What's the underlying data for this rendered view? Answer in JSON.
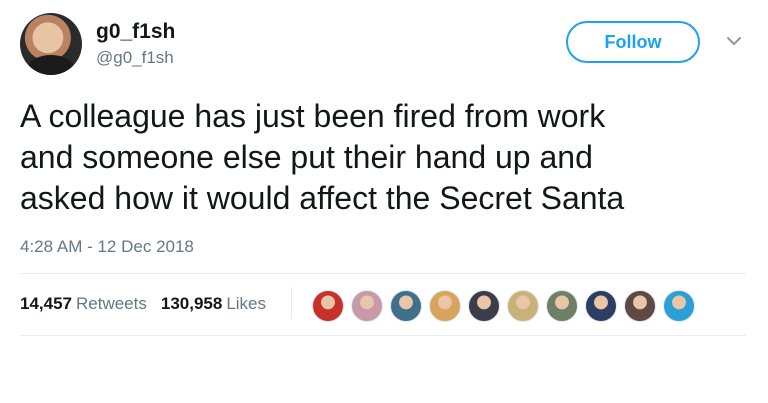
{
  "user": {
    "name": "g0_f1sh",
    "handle": "@g0_f1sh",
    "follow_label": "Follow"
  },
  "tweet": {
    "text_lines": [
      "A colleague has just been fired from work",
      "and someone else put their hand up and",
      "asked how it would affect the Secret Santa"
    ],
    "timestamp": "4:28 AM - 12 Dec 2018"
  },
  "stats": {
    "retweets_count": "14,457",
    "retweets_label": "Retweets",
    "likes_count": "130,958",
    "likes_label": "Likes"
  },
  "likers": [
    {
      "icon": "liker-avatar-1",
      "color": "#c7302b"
    },
    {
      "icon": "liker-avatar-2",
      "color": "#c79aa8"
    },
    {
      "icon": "liker-avatar-3",
      "color": "#3f6f8a"
    },
    {
      "icon": "liker-avatar-4",
      "color": "#d8a35a"
    },
    {
      "icon": "liker-avatar-5",
      "color": "#3d3d4a"
    },
    {
      "icon": "liker-avatar-6",
      "color": "#c9b27a"
    },
    {
      "icon": "liker-avatar-7",
      "color": "#6f7f66"
    },
    {
      "icon": "liker-avatar-8",
      "color": "#2c3e64"
    },
    {
      "icon": "liker-avatar-9",
      "color": "#5e4a42"
    },
    {
      "icon": "liker-avatar-10",
      "color": "#2aa0d8"
    }
  ],
  "colors": {
    "accent": "#1da1f2",
    "muted_text": "#657786",
    "primary_text": "#14171a",
    "divider": "#e6ecf0"
  }
}
